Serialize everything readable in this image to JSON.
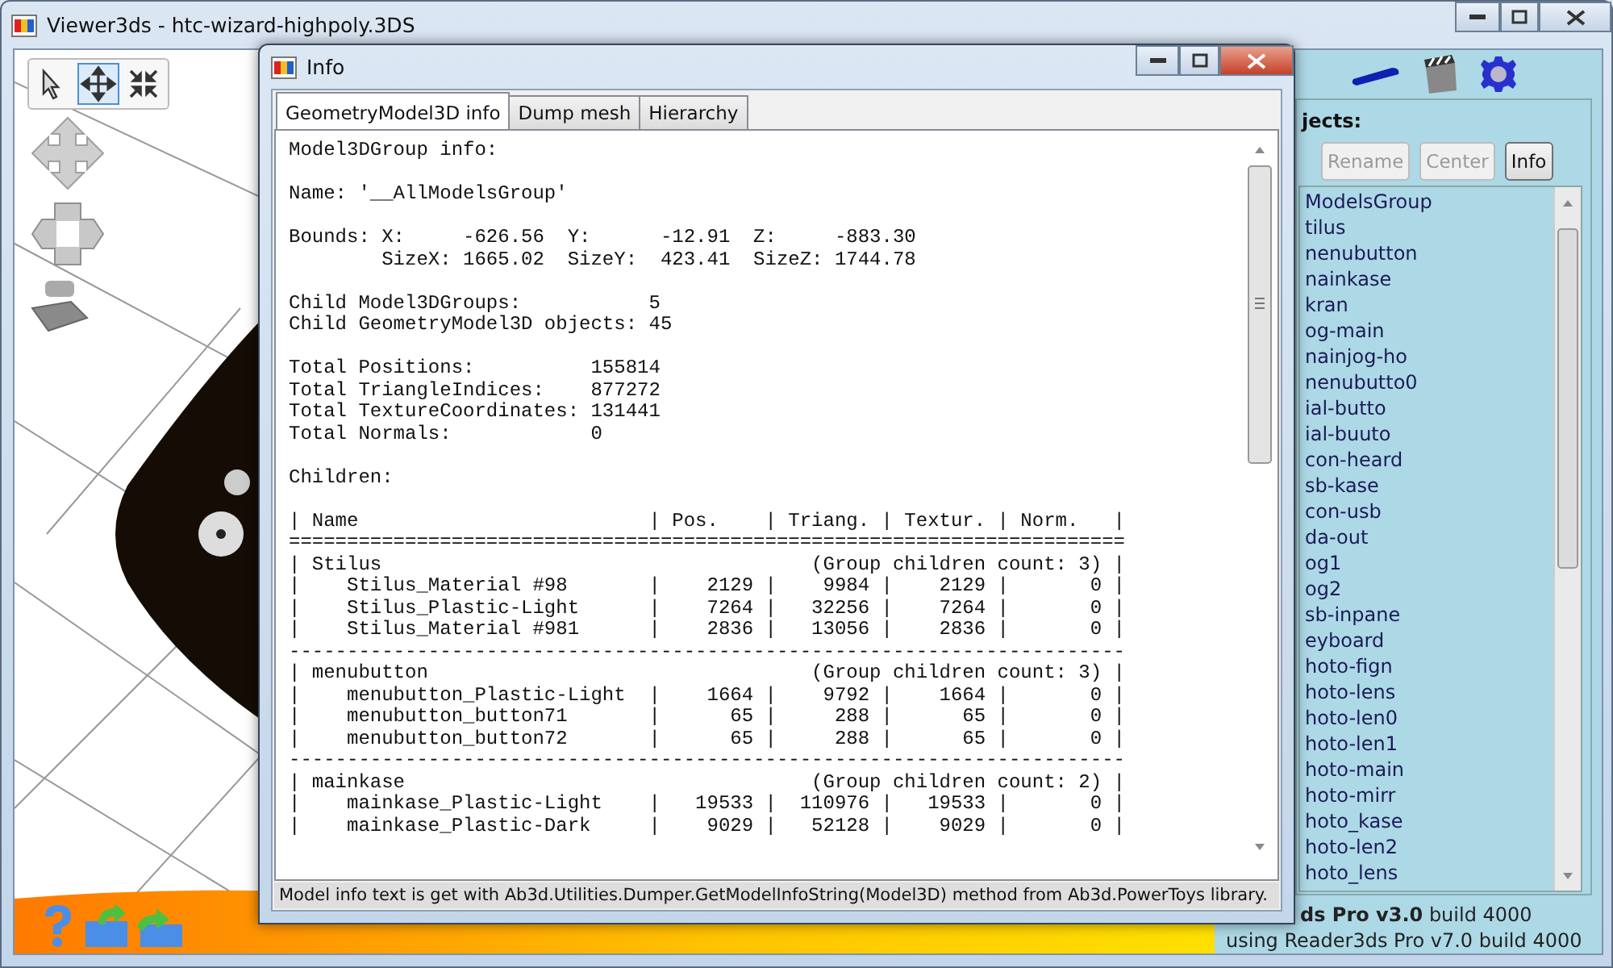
{
  "window": {
    "title": "Viewer3ds - htc-wizard-highpoly.3DS"
  },
  "toolbar": {
    "tools": [
      {
        "selected": false
      },
      {
        "selected": true
      },
      {
        "selected": false
      }
    ]
  },
  "objects_panel": {
    "label": "jects:",
    "buttons": [
      {
        "label": "Rename",
        "disabled": true
      },
      {
        "label": "Center",
        "disabled": true
      },
      {
        "label": "Info",
        "disabled": false
      }
    ],
    "items": [
      "ModelsGroup",
      "tilus",
      "nenubutton",
      "nainkase",
      "kran",
      "og-main",
      "nainjog-ho",
      "nenubutto0",
      "ial-butto",
      "ial-buuto",
      "con-heard",
      "sb-kase",
      "con-usb",
      "da-out",
      "og1",
      "og2",
      "sb-inpane",
      "eyboard",
      "hoto-fign",
      "hoto-lens",
      "hoto-len0",
      "hoto-len1",
      "hoto-main",
      "hoto-mirr",
      "hoto_kase",
      "hoto-len2",
      "hoto_lens"
    ],
    "footer": [
      "**ds Pro v3.0** build 4000",
      "using Reader3ds Pro v7.0 build 4000"
    ]
  },
  "info_dialog": {
    "title": "Info",
    "tabs": [
      {
        "label": "GeometryModel3D info",
        "selected": true
      },
      {
        "label": "Dump mesh",
        "selected": false
      },
      {
        "label": "Hierarchy",
        "selected": false
      }
    ],
    "paragraphs": [
      [
        "Model3DGroup info:"
      ],
      [
        "Name: '__AllModelsGroup'"
      ],
      [
        "Bounds: X:     -626.56  Y:      -12.91  Z:     -883.30",
        "        SizeX: 1665.02  SizeY:  423.41  SizeZ: 1744.78"
      ],
      [
        "Child Model3DGroups:           5",
        "Child GeometryModel3D objects: 45"
      ],
      [
        "Total Positions:          155814",
        "Total TriangleIndices:    877272",
        "Total TextureCoordinates: 131441",
        "Total Normals:            0"
      ],
      [
        "Children:"
      ],
      [
        "| Name                         | Pos.    | Triang. | Textur. | Norm.   |",
        "========================================================================",
        "| Stilus                                     (Group children count: 3) |",
        "|    Stilus_Material #98       |    2129 |    9984 |    2129 |       0 |",
        "|    Stilus_Plastic-Light      |    7264 |   32256 |    7264 |       0 |",
        "|    Stilus_Material #981      |    2836 |   13056 |    2836 |       0 |",
        "------------------------------------------------------------------------",
        "| menubutton                                 (Group children count: 3) |",
        "|    menubutton_Plastic-Light  |    1664 |    9792 |    1664 |       0 |",
        "|    menubutton_button71       |      65 |     288 |      65 |       0 |",
        "|    menubutton_button72       |      65 |     288 |      65 |       0 |",
        "------------------------------------------------------------------------",
        "| mainkase                                   (Group children count: 2) |",
        "|    mainkase_Plastic-Light    |   19533 |  110976 |   19533 |       0 |",
        "|    mainkase_Plastic-Dark     |    9029 |   52128 |    9029 |       0 |"
      ]
    ],
    "status": "Model info text is get with Ab3d.Utilities.Dumper.GetModelInfoString(Model3D) method from Ab3d.PowerToys library."
  }
}
